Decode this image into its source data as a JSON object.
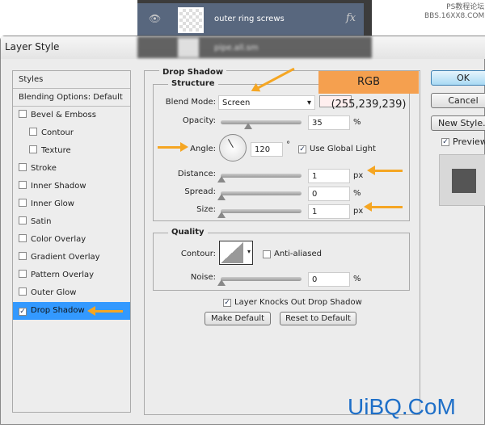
{
  "layers_panel": {
    "layer_name": "outer ring screws",
    "fx": "fx",
    "blurred_layer": "pipe.all.sm"
  },
  "watermark_top": [
    "PS教程论坛",
    "BBS.16XX8.COM"
  ],
  "watermark_bottom": "UiBQ.CoM",
  "dialog": {
    "title": "Layer Style"
  },
  "styles_list": [
    {
      "label": "Styles",
      "checkbox": false
    },
    {
      "label": "Blending Options: Default",
      "checkbox": false
    },
    {
      "label": "Bevel & Emboss",
      "checkbox": true,
      "checked": false
    },
    {
      "label": "Contour",
      "checkbox": true,
      "checked": false,
      "indent": true
    },
    {
      "label": "Texture",
      "checkbox": true,
      "checked": false,
      "indent": true
    },
    {
      "label": "Stroke",
      "checkbox": true,
      "checked": false
    },
    {
      "label": "Inner Shadow",
      "checkbox": true,
      "checked": false
    },
    {
      "label": "Inner Glow",
      "checkbox": true,
      "checked": false
    },
    {
      "label": "Satin",
      "checkbox": true,
      "checked": false
    },
    {
      "label": "Color Overlay",
      "checkbox": true,
      "checked": false
    },
    {
      "label": "Gradient Overlay",
      "checkbox": true,
      "checked": false
    },
    {
      "label": "Pattern Overlay",
      "checkbox": true,
      "checked": false
    },
    {
      "label": "Outer Glow",
      "checkbox": true,
      "checked": false
    },
    {
      "label": "Drop Shadow",
      "checkbox": true,
      "checked": true,
      "selected": true
    }
  ],
  "drop_shadow": {
    "heading": "Drop Shadow",
    "structure": "Structure",
    "blend_mode_label": "Blend Mode:",
    "blend_mode": "Screen",
    "shadow_color": "#ffefef",
    "opacity_label": "Opacity:",
    "opacity": "35",
    "opacity_unit": "%",
    "angle_label": "Angle:",
    "angle": "120",
    "angle_unit": "°",
    "use_global_light": "Use Global Light",
    "distance_label": "Distance:",
    "distance": "1",
    "distance_unit": "px",
    "spread_label": "Spread:",
    "spread": "0",
    "spread_unit": "%",
    "size_label": "Size:",
    "size": "1",
    "size_unit": "px",
    "quality": "Quality",
    "contour_label": "Contour:",
    "anti_aliased": "Anti-aliased",
    "noise_label": "Noise:",
    "noise": "0",
    "noise_unit": "%",
    "knockout": "Layer Knocks Out Drop Shadow",
    "make_default": "Make Default",
    "reset_default": "Reset to Default"
  },
  "buttons": {
    "ok": "OK",
    "cancel": "Cancel",
    "new_style": "New Style...",
    "preview": "Preview"
  },
  "annotation": {
    "rgb": "RGB (255,239,239)",
    "color": "#f5a04f"
  },
  "accent": "#3399ff"
}
